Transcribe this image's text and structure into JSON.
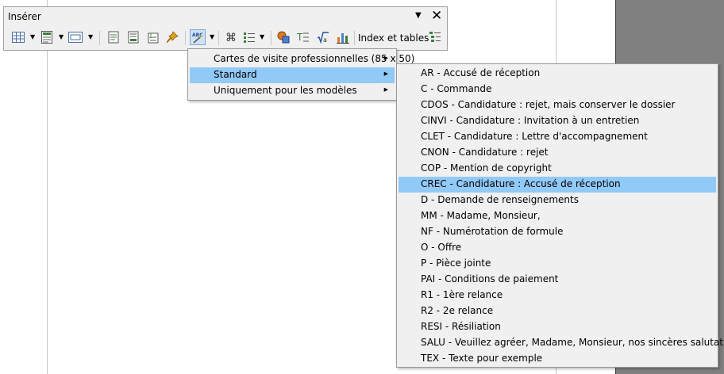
{
  "toolbar": {
    "title": "Insérer",
    "menu_arrow": "▼",
    "close": "✕",
    "index_label": "Index et tables"
  },
  "menu1": {
    "items": [
      {
        "label": "Cartes de visite professionnelles (85 x 50)",
        "arrow": "▶"
      },
      {
        "label": "Standard",
        "arrow": "▶"
      },
      {
        "label": "Uniquement pour les modèles",
        "arrow": "▶"
      }
    ]
  },
  "menu2": {
    "items": [
      "AR - Accusé de réception",
      "C - Commande",
      "CDOS - Candidature : rejet, mais conserver le dossier",
      "CINVI - Candidature : Invitation à un entretien",
      "CLET - Candidature : Lettre d'accompagnement",
      "CNON - Candidature : rejet",
      "COP - Mention de copyright",
      "CREC - Candidature : Accusé de réception",
      "D - Demande de renseignements",
      "MM - Madame, Monsieur,",
      "NF - Numérotation de formule",
      "O - Offre",
      "P - Pièce jointe",
      "PAI - Conditions de paiement",
      "R1 - 1ère relance",
      "R2 - 2e relance",
      "RESI - Résiliation",
      "SALU - Veuillez agréer, Madame, Monsieur, nos sincères salutations.",
      "TEX - Texte pour exemple"
    ]
  },
  "colors": {
    "highlight": "#91c9f7",
    "menu_bg": "#f0f0f0",
    "margin_gray": "#808080"
  }
}
